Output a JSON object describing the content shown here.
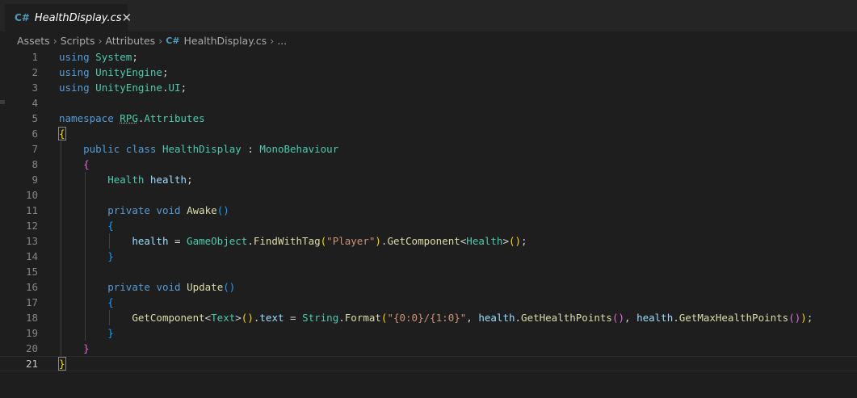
{
  "tab": {
    "title": "HealthDisplay.cs",
    "icon": "csharp-file-icon",
    "close_glyph": "✕",
    "file_glyph": "C#"
  },
  "breadcrumb": {
    "items": [
      "Assets",
      "Scripts",
      "Attributes"
    ],
    "file": "HealthDisplay.cs",
    "ellipsis": "..."
  },
  "colors": {
    "keyword": "#569cd6",
    "type": "#4ec9b0",
    "variable": "#9cdcfe",
    "function": "#dcdcaa",
    "string": "#ce9178",
    "bracket1": "#ffd700",
    "bracket2": "#da70d6",
    "bracket3": "#179fff",
    "background": "#1e1e1e"
  },
  "editor": {
    "active_line": 21,
    "lines": [
      {
        "n": "1",
        "indent": 0,
        "tokens": [
          [
            "using",
            "kw"
          ],
          [
            " ",
            "plain"
          ],
          [
            "System",
            "type"
          ],
          [
            ";",
            "plain"
          ]
        ]
      },
      {
        "n": "2",
        "indent": 0,
        "tokens": [
          [
            "using",
            "kw"
          ],
          [
            " ",
            "plain"
          ],
          [
            "UnityEngine",
            "type"
          ],
          [
            ";",
            "plain"
          ]
        ]
      },
      {
        "n": "3",
        "indent": 0,
        "tokens": [
          [
            "using",
            "kw"
          ],
          [
            " ",
            "plain"
          ],
          [
            "UnityEngine",
            "type"
          ],
          [
            ".",
            "plain"
          ],
          [
            "UI",
            "type"
          ],
          [
            ";",
            "plain"
          ]
        ]
      },
      {
        "n": "4",
        "indent": 0,
        "tokens": []
      },
      {
        "n": "5",
        "indent": 0,
        "tokens": [
          [
            "namespace",
            "kw"
          ],
          [
            " ",
            "plain"
          ],
          [
            "RPG",
            "type ul"
          ],
          [
            ".",
            "plain"
          ],
          [
            "Attributes",
            "type"
          ]
        ]
      },
      {
        "n": "6",
        "indent": 0,
        "tokens": [
          [
            "{",
            "p1 boxed"
          ]
        ]
      },
      {
        "n": "7",
        "indent": 1,
        "tokens": [
          [
            "    ",
            "plain"
          ],
          [
            "public",
            "kw"
          ],
          [
            " ",
            "plain"
          ],
          [
            "class",
            "kw"
          ],
          [
            " ",
            "plain"
          ],
          [
            "HealthDisplay",
            "type"
          ],
          [
            " : ",
            "plain"
          ],
          [
            "MonoBehaviour",
            "type"
          ]
        ]
      },
      {
        "n": "8",
        "indent": 1,
        "tokens": [
          [
            "    ",
            "plain"
          ],
          [
            "{",
            "p2"
          ]
        ]
      },
      {
        "n": "9",
        "indent": 2,
        "tokens": [
          [
            "        ",
            "plain"
          ],
          [
            "Health",
            "type"
          ],
          [
            " ",
            "plain"
          ],
          [
            "health",
            "var"
          ],
          [
            ";",
            "plain"
          ]
        ]
      },
      {
        "n": "10",
        "indent": 2,
        "tokens": []
      },
      {
        "n": "11",
        "indent": 2,
        "tokens": [
          [
            "        ",
            "plain"
          ],
          [
            "private",
            "kw"
          ],
          [
            " ",
            "plain"
          ],
          [
            "void",
            "kw"
          ],
          [
            " ",
            "plain"
          ],
          [
            "Awake",
            "fn"
          ],
          [
            "()",
            "p3"
          ]
        ]
      },
      {
        "n": "12",
        "indent": 2,
        "tokens": [
          [
            "        ",
            "plain"
          ],
          [
            "{",
            "p3"
          ]
        ]
      },
      {
        "n": "13",
        "indent": 3,
        "tokens": [
          [
            "            ",
            "plain"
          ],
          [
            "health",
            "var"
          ],
          [
            " = ",
            "plain"
          ],
          [
            "GameObject",
            "type"
          ],
          [
            ".",
            "plain"
          ],
          [
            "FindWithTag",
            "fn"
          ],
          [
            "(",
            "p1"
          ],
          [
            "\"Player\"",
            "str"
          ],
          [
            ")",
            "p1"
          ],
          [
            ".",
            "plain"
          ],
          [
            "GetComponent",
            "fn"
          ],
          [
            "<",
            "plain"
          ],
          [
            "Health",
            "type"
          ],
          [
            ">",
            "plain"
          ],
          [
            "()",
            "p1"
          ],
          [
            ";",
            "plain"
          ]
        ]
      },
      {
        "n": "14",
        "indent": 2,
        "tokens": [
          [
            "        ",
            "plain"
          ],
          [
            "}",
            "p3"
          ]
        ]
      },
      {
        "n": "15",
        "indent": 2,
        "tokens": []
      },
      {
        "n": "16",
        "indent": 2,
        "tokens": [
          [
            "        ",
            "plain"
          ],
          [
            "private",
            "kw"
          ],
          [
            " ",
            "plain"
          ],
          [
            "void",
            "kw"
          ],
          [
            " ",
            "plain"
          ],
          [
            "Update",
            "fn"
          ],
          [
            "()",
            "p3"
          ]
        ]
      },
      {
        "n": "17",
        "indent": 2,
        "tokens": [
          [
            "        ",
            "plain"
          ],
          [
            "{",
            "p3"
          ]
        ]
      },
      {
        "n": "18",
        "indent": 3,
        "tokens": [
          [
            "            ",
            "plain"
          ],
          [
            "GetComponent",
            "fn"
          ],
          [
            "<",
            "plain"
          ],
          [
            "Text",
            "type"
          ],
          [
            ">",
            "plain"
          ],
          [
            "()",
            "p1"
          ],
          [
            ".",
            "plain"
          ],
          [
            "text",
            "var"
          ],
          [
            " = ",
            "plain"
          ],
          [
            "String",
            "type"
          ],
          [
            ".",
            "plain"
          ],
          [
            "Format",
            "fn"
          ],
          [
            "(",
            "p1"
          ],
          [
            "\"{0:0}/{1:0}\"",
            "str"
          ],
          [
            ", ",
            "plain"
          ],
          [
            "health",
            "var"
          ],
          [
            ".",
            "plain"
          ],
          [
            "GetHealthPoints",
            "fn"
          ],
          [
            "()",
            "p2"
          ],
          [
            ", ",
            "plain"
          ],
          [
            "health",
            "var"
          ],
          [
            ".",
            "plain"
          ],
          [
            "GetMaxHealthPoints",
            "fn"
          ],
          [
            "()",
            "p2"
          ],
          [
            ")",
            "p1"
          ],
          [
            ";",
            "plain"
          ]
        ]
      },
      {
        "n": "19",
        "indent": 2,
        "tokens": [
          [
            "        ",
            "plain"
          ],
          [
            "}",
            "p3"
          ]
        ]
      },
      {
        "n": "20",
        "indent": 1,
        "tokens": [
          [
            "    ",
            "plain"
          ],
          [
            "}",
            "p2"
          ]
        ]
      },
      {
        "n": "21",
        "indent": 0,
        "tokens": [
          [
            "}",
            "p1 boxed"
          ]
        ]
      }
    ]
  }
}
